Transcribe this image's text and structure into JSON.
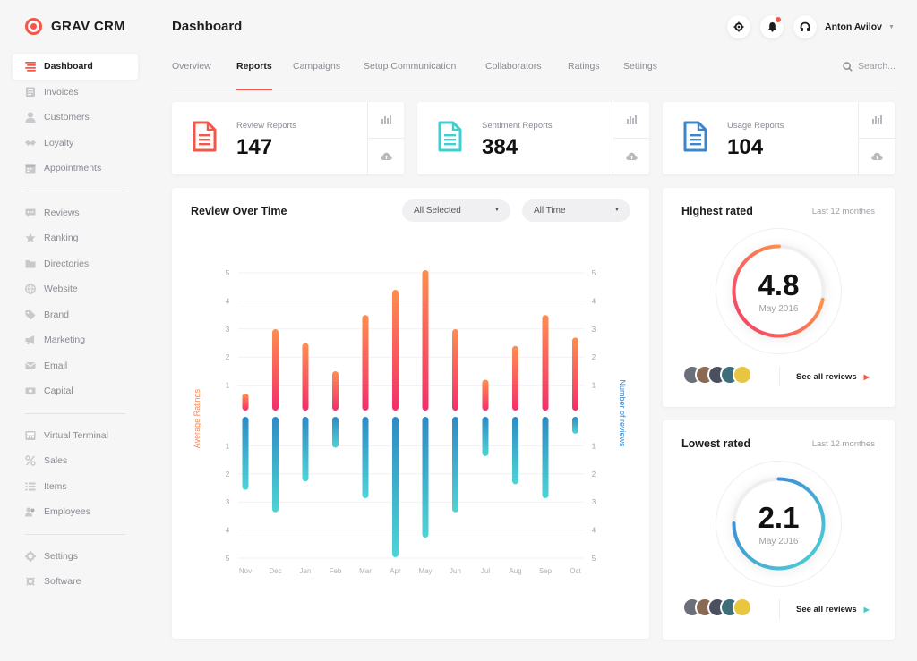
{
  "brand": {
    "name": "GRAV CRM",
    "accent": "#f2584a"
  },
  "sidebar": {
    "groups": [
      [
        {
          "label": "Dashboard",
          "icon": "dashboard-icon",
          "active": true
        },
        {
          "label": "Invoices",
          "icon": "invoice-icon"
        },
        {
          "label": "Customers",
          "icon": "user-icon"
        },
        {
          "label": "Loyalty",
          "icon": "handshake-icon"
        },
        {
          "label": "Appointments",
          "icon": "calendar-icon"
        }
      ],
      [
        {
          "label": "Reviews",
          "icon": "chat-icon"
        },
        {
          "label": "Ranking",
          "icon": "star-icon"
        },
        {
          "label": "Directories",
          "icon": "folder-icon"
        },
        {
          "label": "Website",
          "icon": "globe-icon"
        },
        {
          "label": "Brand",
          "icon": "tag-icon"
        },
        {
          "label": "Marketing",
          "icon": "megaphone-icon"
        },
        {
          "label": "Email",
          "icon": "mail-icon"
        },
        {
          "label": "Capital",
          "icon": "money-icon"
        }
      ],
      [
        {
          "label": "Virtual Terminal",
          "icon": "terminal-icon"
        },
        {
          "label": "Sales",
          "icon": "percent-icon"
        },
        {
          "label": "Items",
          "icon": "list-icon"
        },
        {
          "label": "Employees",
          "icon": "users-icon"
        }
      ],
      [
        {
          "label": "Settings",
          "icon": "gear-icon"
        },
        {
          "label": "Software",
          "icon": "cog-icon"
        }
      ]
    ]
  },
  "header": {
    "title": "Dashboard",
    "user_name": "Anton Avilov"
  },
  "tabs": [
    {
      "label": "Overview"
    },
    {
      "label": "Reports",
      "active": true
    },
    {
      "label": "Campaigns"
    },
    {
      "label": "Setup Communication"
    },
    {
      "label": "Collaborators"
    },
    {
      "label": "Ratings"
    },
    {
      "label": "Settings"
    }
  ],
  "search": {
    "placeholder": "Search..."
  },
  "reports": [
    {
      "label": "Review Reports",
      "value": "147",
      "color": "#f2584a"
    },
    {
      "label": "Sentiment Reports",
      "value": "384",
      "color": "#3ecfd0"
    },
    {
      "label": "Usage Reports",
      "value": "104",
      "color": "#3a86c8"
    }
  ],
  "review_chart": {
    "title": "Review Over Time",
    "filter_selection": "All Selected",
    "filter_time": "All Time",
    "y_left_label": "Average Ratings",
    "y_right_label": "Number of reviews",
    "top_ticks": [
      "5",
      "4",
      "3",
      "2",
      "1"
    ],
    "bottom_ticks": [
      "1",
      "2",
      "3",
      "4",
      "5"
    ]
  },
  "chart_data": {
    "type": "bar",
    "title": "Review Over Time",
    "categories": [
      "Nov",
      "Dec",
      "Jan",
      "Feb",
      "Mar",
      "Apr",
      "May",
      "Jun",
      "Jul",
      "Aug",
      "Sep",
      "Oct"
    ],
    "series": [
      {
        "name": "Average Ratings",
        "values": [
          0.6,
          2.9,
          2.4,
          1.4,
          3.4,
          4.3,
          5.0,
          2.9,
          1.1,
          2.3,
          3.4,
          2.6
        ],
        "color_top": "#ff8e4f",
        "color_bottom": "#f22f6b"
      },
      {
        "name": "Number of reviews",
        "values": [
          2.6,
          3.4,
          2.3,
          1.1,
          2.9,
          5.0,
          4.3,
          3.4,
          1.4,
          2.4,
          2.9,
          0.6
        ],
        "color_top": "#2f8bc4",
        "color_bottom": "#4ed4d4"
      }
    ],
    "ylim": [
      0,
      5
    ],
    "xlabel": "",
    "ylabel": "Average Ratings"
  },
  "ratings": [
    {
      "title": "Highest rated",
      "period": "Last 12 monthes",
      "value": "4.8",
      "date": "May 2016",
      "fraction": 0.72,
      "color_start": "#f23a6d",
      "color_end": "#ffb33f",
      "link": "See all reviews",
      "link_color": "#f2584a"
    },
    {
      "title": "Lowest rated",
      "period": "Last 12 monthes",
      "value": "2.1",
      "date": "May 2016",
      "fraction": 0.75,
      "color_start": "#4ed4d4",
      "color_end": "#3a78d4",
      "link": "See all reviews",
      "link_color": "#3ecfd0"
    }
  ],
  "avatar_colors": [
    "#6b6f7a",
    "#8a6a55",
    "#4a5060",
    "#3f6e7a",
    "#e8c640"
  ]
}
